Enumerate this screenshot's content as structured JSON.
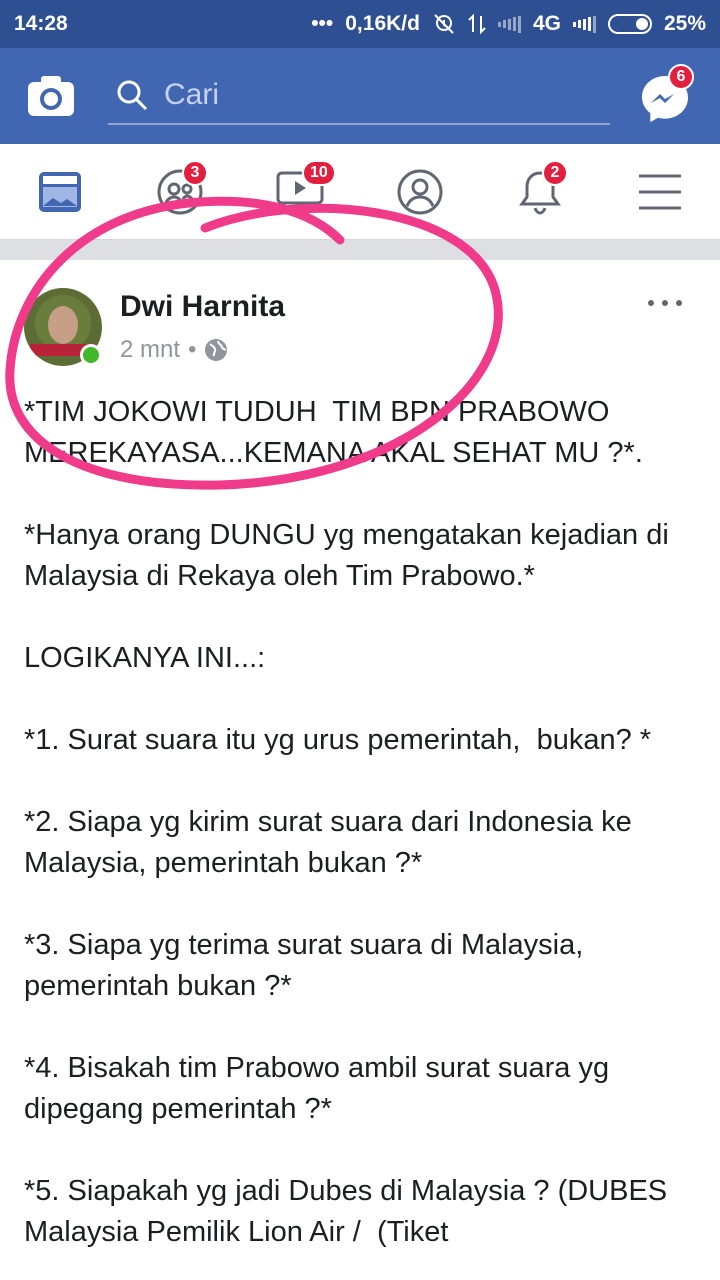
{
  "status_bar": {
    "time": "14:28",
    "dots": "•••",
    "speed": "0,16K/d",
    "network": "4G",
    "battery": "25%",
    "icons": [
      "alarm-off-icon",
      "data-transfer-icon",
      "signal-icon",
      "battery-icon"
    ]
  },
  "header": {
    "search_placeholder": "Cari",
    "messenger_badge": "6",
    "accent_color": "#4267b2",
    "status_color": "#2f4f93"
  },
  "nav": {
    "tabs": [
      {
        "name": "news-feed",
        "icon": "news-feed-icon",
        "badge": ""
      },
      {
        "name": "friends",
        "icon": "friends-icon",
        "badge": "3"
      },
      {
        "name": "watch",
        "icon": "watch-icon",
        "badge": "10"
      },
      {
        "name": "profile",
        "icon": "profile-icon",
        "badge": ""
      },
      {
        "name": "notifications",
        "icon": "bell-icon",
        "badge": "2"
      },
      {
        "name": "menu",
        "icon": "menu-icon",
        "badge": ""
      }
    ]
  },
  "post": {
    "author": "Dwi Harnita",
    "time": "2 mnt",
    "separator": "•",
    "privacy_icon": "globe-icon",
    "paragraphs": [
      "*TIM JOKOWI TUDUH  TIM BPN PRABOWO MEREKAYASA...KEMANA AKAL SEHAT MU ?*.",
      "*Hanya orang DUNGU yg mengatakan kejadian di Malaysia di Rekaya oleh Tim Prabowo.*",
      "LOGIKANYA INI...:",
      "*1. Surat suara itu yg urus pemerintah,  bukan? *",
      "*2. Siapa yg kirim surat suara dari Indonesia ke Malaysia, pemerintah bukan ?*",
      "*3. Siapa yg terima surat suara di Malaysia, pemerintah bukan ?*",
      "*4. Bisakah tim Prabowo ambil surat suara yg dipegang pemerintah ?*",
      "*5. Siapakah yg jadi Dubes di Malaysia ? (DUBES Malaysia Pemilik Lion Air /  (Tiket"
    ]
  }
}
